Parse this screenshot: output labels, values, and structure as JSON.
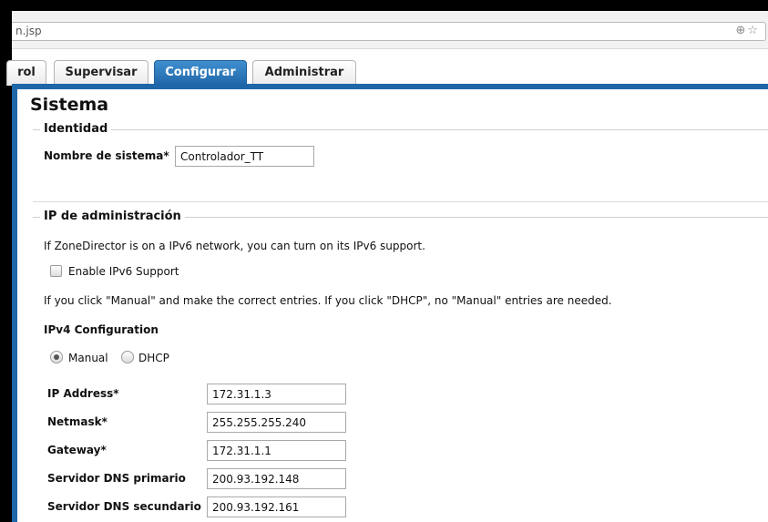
{
  "browser": {
    "url": "n.jsp",
    "icons": [
      "zoom-icon",
      "star-icon"
    ]
  },
  "tabs": [
    {
      "label": "rol",
      "active": false
    },
    {
      "label": "Supervisar",
      "active": false
    },
    {
      "label": "Configurar",
      "active": true
    },
    {
      "label": "Administrar",
      "active": false
    }
  ],
  "page": {
    "title": "Sistema"
  },
  "identity": {
    "legend": "Identidad",
    "system_name_label": "Nombre de sistema*",
    "system_name_value": "Controlador_TT"
  },
  "admin_ip": {
    "legend": "IP de administración",
    "ipv6_info": "If ZoneDirector is on a IPv6 network, you can turn on its IPv6 support.",
    "ipv6_checkbox_label": "Enable IPv6 Support",
    "ipv6_checked": false,
    "manual_info": "If you click \"Manual\" and make the correct entries. If you click \"DHCP\", no \"Manual\" entries are needed.",
    "ipv4_heading": "IPv4 Configuration",
    "mode_options": [
      "Manual",
      "DHCP"
    ],
    "mode_selected": "Manual",
    "fields": [
      {
        "label": "IP Address*",
        "value": "172.31.1.3"
      },
      {
        "label": "Netmask*",
        "value": "255.255.255.240"
      },
      {
        "label": "Gateway*",
        "value": "172.31.1.1"
      },
      {
        "label": "Servidor DNS primario",
        "value": "200.93.192.148"
      },
      {
        "label": "Servidor DNS secundario",
        "value": "200.93.192.161"
      }
    ]
  },
  "colors": {
    "accent": "#1f66a8",
    "frame": "#000000"
  }
}
